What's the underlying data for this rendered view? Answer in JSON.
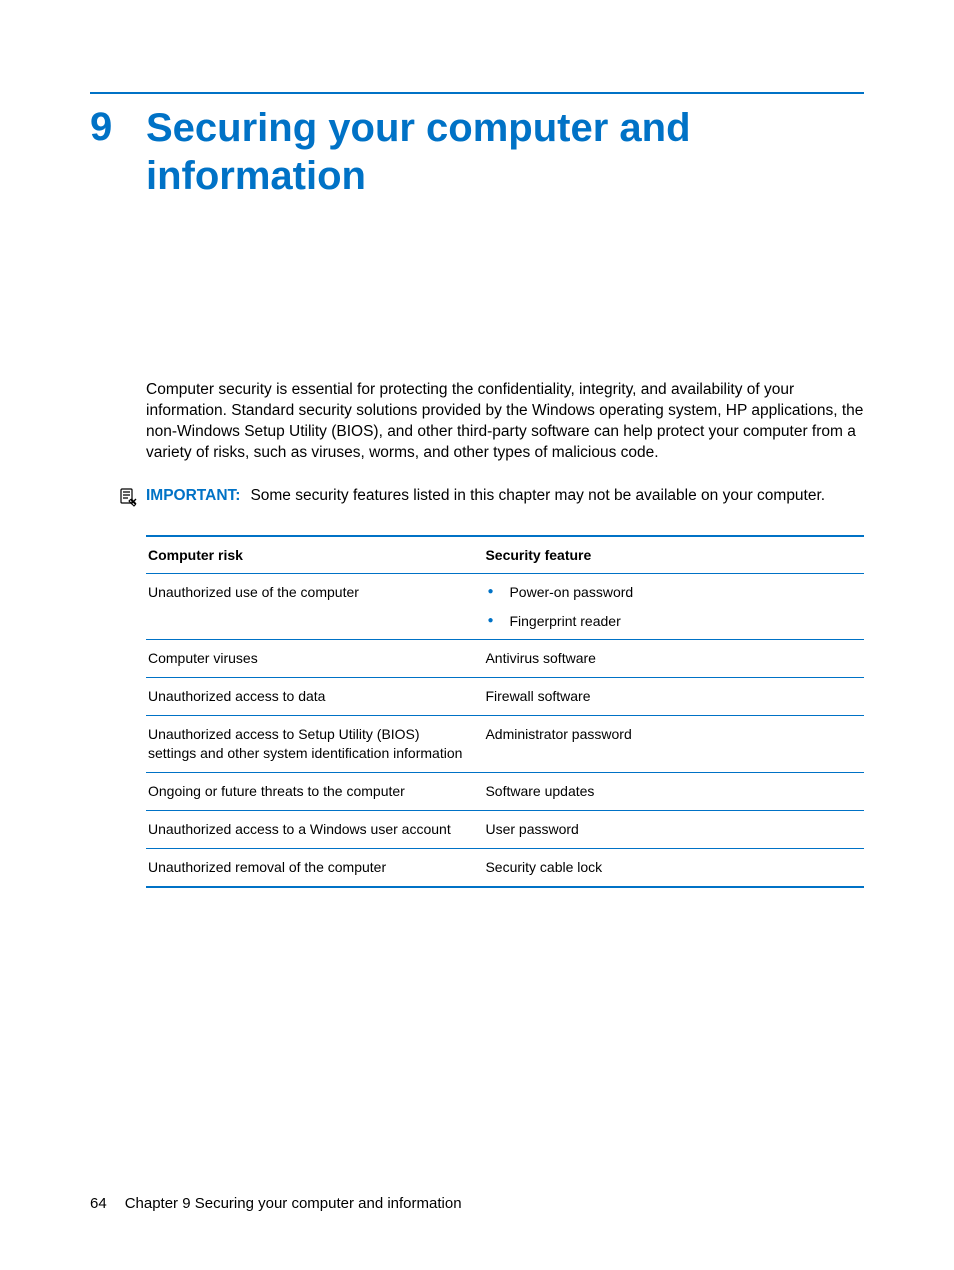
{
  "chapter": {
    "number": "9",
    "title": "Securing your computer and information"
  },
  "intro": "Computer security is essential for protecting the confidentiality, integrity, and availability of your information. Standard security solutions provided by the Windows operating system, HP applications, the non-Windows Setup Utility (BIOS), and other third-party software can help protect your computer from a variety of risks, such as viruses, worms, and other types of malicious code.",
  "notice": {
    "label": "IMPORTANT:",
    "text": "Some security features listed in this chapter may not be available on your computer."
  },
  "table": {
    "headers": [
      "Computer risk",
      "Security feature"
    ],
    "rows": [
      {
        "risk": "Unauthorized use of the computer",
        "feature_list": [
          "Power-on password",
          "Fingerprint reader"
        ]
      },
      {
        "risk": "Computer viruses",
        "feature": "Antivirus software"
      },
      {
        "risk": "Unauthorized access to data",
        "feature": "Firewall software"
      },
      {
        "risk": "Unauthorized access to Setup Utility (BIOS) settings and other system identification information",
        "feature": "Administrator password"
      },
      {
        "risk": "Ongoing or future threats to the computer",
        "feature": "Software updates"
      },
      {
        "risk": "Unauthorized access to a Windows user account",
        "feature": "User password"
      },
      {
        "risk": "Unauthorized removal of the computer",
        "feature": "Security cable lock"
      }
    ]
  },
  "footer": {
    "page_number": "64",
    "chapter_ref": "Chapter 9   Securing your computer and information"
  }
}
